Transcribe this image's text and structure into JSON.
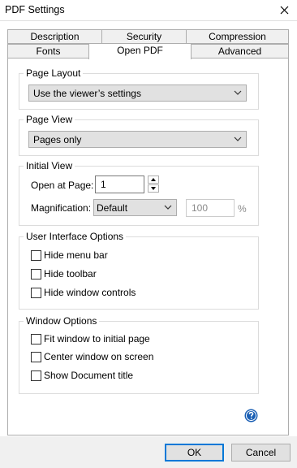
{
  "window": {
    "title": "PDF Settings",
    "close_icon": "close-icon"
  },
  "tabs": {
    "back_row": [
      "Description",
      "Security",
      "Compression"
    ],
    "front_row": [
      "Fonts",
      "Open PDF",
      "Advanced"
    ],
    "active": "Open PDF"
  },
  "page_layout": {
    "legend": "Page Layout",
    "selected": "Use the viewer’s settings"
  },
  "page_view": {
    "legend": "Page View",
    "selected": "Pages only"
  },
  "initial_view": {
    "legend": "Initial View",
    "open_at_page_label": "Open at Page:",
    "open_at_page_value": "1",
    "magnification_label": "Magnification:",
    "magnification_selected": "Default",
    "zoom_value": "100",
    "zoom_unit": "%"
  },
  "ui_options": {
    "legend": "User Interface Options",
    "items": [
      "Hide menu bar",
      "Hide toolbar",
      "Hide window controls"
    ],
    "checked": [
      false,
      false,
      false
    ]
  },
  "window_options": {
    "legend": "Window Options",
    "items": [
      "Fit window to initial page",
      "Center window on screen",
      "Show Document title"
    ],
    "checked": [
      false,
      false,
      false
    ]
  },
  "buttons": {
    "ok": "OK",
    "cancel": "Cancel",
    "help_icon": "help-icon"
  },
  "colors": {
    "help_blue": "#1a5fb4",
    "default_button_border": "#0078d7"
  }
}
